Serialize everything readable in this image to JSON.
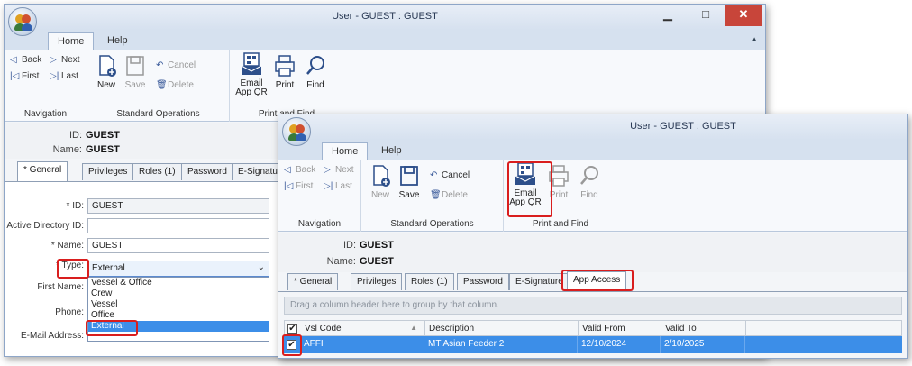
{
  "window1": {
    "title": "User - GUEST : GUEST",
    "tabs": [
      "Home",
      "Help"
    ],
    "nav": {
      "back": "Back",
      "next": "Next",
      "first": "First",
      "last": "Last",
      "group": "Navigation"
    },
    "std": {
      "new": "New",
      "save": "Save",
      "cancel": "Cancel",
      "delete": "Delete",
      "group": "Standard Operations"
    },
    "pf": {
      "email": "Email App QR",
      "print": "Print",
      "find": "Find",
      "group": "Print and Find"
    },
    "header": {
      "id_label": "ID:",
      "id_value": "GUEST",
      "name_label": "Name:",
      "name_value": "GUEST"
    },
    "form_tabs": [
      "* General",
      "Privileges",
      "Roles (1)",
      "Password",
      "E-Signatu"
    ],
    "form": {
      "id_label": "* ID:",
      "id_value": "GUEST",
      "ad_label": "Active Directory ID:",
      "ad_value": "",
      "name_label": "* Name:",
      "name_value": "GUEST",
      "type_label": "* Type:",
      "type_value": "External",
      "first_label": "First Name:",
      "phone_label": "Phone:",
      "email_label": "E-Mail Address:"
    },
    "type_options": [
      "Vessel & Office",
      "Crew",
      "Vessel",
      "Office",
      "External"
    ]
  },
  "window2": {
    "title": "User - GUEST : GUEST",
    "tabs": [
      "Home",
      "Help"
    ],
    "nav": {
      "back": "Back",
      "next": "Next",
      "first": "First",
      "last": "Last",
      "group": "Navigation"
    },
    "std": {
      "new": "New",
      "save": "Save",
      "cancel": "Cancel",
      "delete": "Delete",
      "group": "Standard Operations"
    },
    "pf": {
      "email": "Email App QR",
      "print": "Print",
      "find": "Find",
      "group": "Print and Find"
    },
    "header": {
      "id_label": "ID:",
      "id_value": "GUEST",
      "name_label": "Name:",
      "name_value": "GUEST"
    },
    "form_tabs": [
      "* General",
      "Privileges",
      "Roles (1)",
      "Password",
      "E-Signature",
      "App Access"
    ],
    "grid": {
      "group_hint": "Drag a column header here to group by that column.",
      "columns": [
        "Vsl Code",
        "Description",
        "Valid From",
        "Valid To"
      ],
      "rows": [
        {
          "checked": "✔",
          "code": "AFFI",
          "description": "MT Asian Feeder 2",
          "from": "12/10/2024",
          "to": "2/10/2025"
        }
      ]
    }
  },
  "colors": {
    "highlight": "#d91e1e",
    "selection": "#3c8ee8",
    "close": "#c8453a"
  }
}
